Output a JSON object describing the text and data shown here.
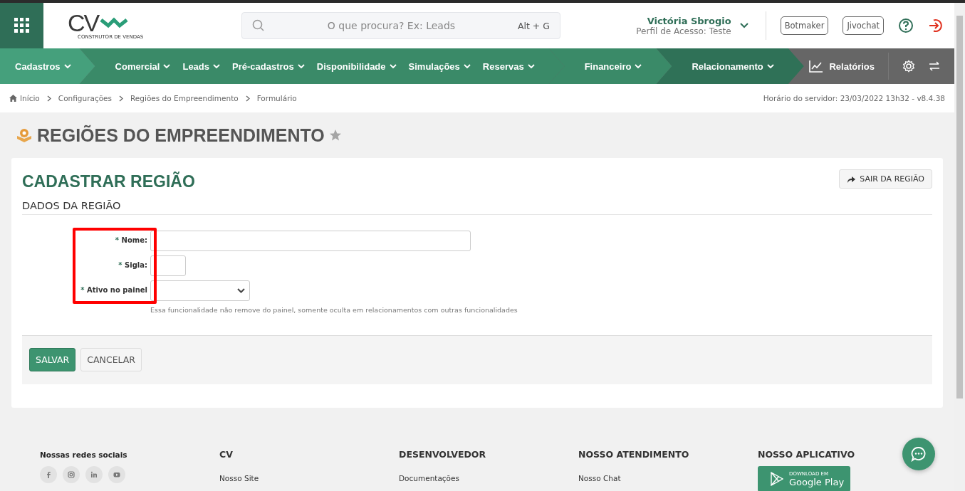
{
  "logo": {
    "mark": "CV",
    "tagline": "CONSTRUTOR DE VENDAS"
  },
  "search": {
    "placeholder": "O que procura? Ex: Leads",
    "shortcut": "Alt + G"
  },
  "user": {
    "name": "Victória Sbrogio",
    "profile": "Perfil de Acesso: Teste"
  },
  "header_buttons": [
    "Botmaker",
    "Jivochat"
  ],
  "nav": {
    "groups": [
      {
        "items": [
          "Cadastros"
        ]
      },
      {
        "items": [
          "Comercial",
          "Leads",
          "Pré-cadastros",
          "Disponibilidade",
          "Simulações",
          "Reservas"
        ]
      },
      {
        "items": [
          "Financeiro"
        ]
      },
      {
        "items": [
          "Relacionamento"
        ]
      }
    ],
    "reports": "Relatórios"
  },
  "breadcrumb": [
    "Início",
    "Configurações",
    "Regiões do Empreendimento",
    "Formulário"
  ],
  "server_time": "Horário do servidor: 23/03/2022 13h32 - v8.4.38",
  "page_title": "REGIÕES DO EMPREENDIMENTO",
  "favorite": false,
  "card": {
    "title": "CADASTRAR REGIÃO",
    "exit_button": "SAIR DA REGIÃO",
    "section": "DADOS DA REGIÃO",
    "fields": [
      {
        "kind": "text",
        "label": "Nome:"
      },
      {
        "kind": "short",
        "label": "Sigla:"
      },
      {
        "kind": "select",
        "label": "Ativo no painel",
        "hint": "Essa funcionalidade não remove do painel, somente oculta em relacionamentos com outras funcionalidades"
      }
    ],
    "labels_highlighted": true,
    "required_mark": "*",
    "save": "SALVAR",
    "cancel": "CANCELAR"
  },
  "footer": {
    "social_title": "Nossas redes sociais",
    "columns": [
      {
        "title": "CV",
        "link": "Nosso Site"
      },
      {
        "title": "DESENVOLVEDOR",
        "link": "Documentações"
      },
      {
        "title": "NOSSO ATENDIMENTO",
        "link": "Nosso Chat"
      }
    ],
    "app": {
      "title": "NOSSO APLICATIVO",
      "badge_small": "DOWNLOAD EM",
      "badge_big": "Google Play"
    }
  }
}
